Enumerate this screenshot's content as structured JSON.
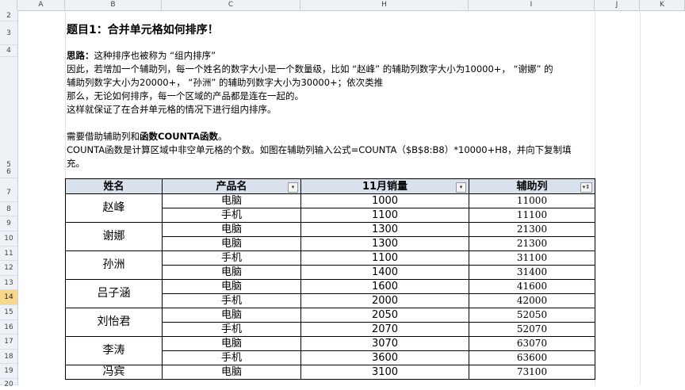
{
  "columns": [
    "A",
    "B",
    "C",
    "H",
    "I",
    "J",
    "K"
  ],
  "rows": [
    "2",
    "3",
    "4",
    "5",
    "6",
    "7",
    "8",
    "9",
    "10",
    "11",
    "12",
    "13",
    "14",
    "15",
    "16",
    "17",
    "18",
    "19",
    "20"
  ],
  "title": "题目1：合并单元格如何排序！",
  "idea": {
    "label": "思路：",
    "line1": "这种排序也被称为 “组内排序”",
    "line2": "因此，若增加一个辅助列，每一个姓名的数字大小是一个数量级，比如 “赵峰” 的辅助列数字大小为10000+， “谢娜” 的",
    "line3": "辅助列数字大小为20000+， “孙洲” 的辅助列数字大小为30000+；依次类推",
    "line4": "那么，无论如何排序，每一个区域的产品都是连在一起的。",
    "line5": " 这样就保证了在合并单元格的情况下进行组内排序。",
    "line6_pre": "需要借助辅助列和",
    "line6_bold": "函数COUNTA函数",
    "line6_post": "。",
    "line7": "COUNTA函数是计算区域中非空单元格的个数。如图在辅助列输入公式=COUNTA（$B$8:B8）*10000+H8，并向下复制填",
    "line8": "充。"
  },
  "table": {
    "headers": [
      "姓名",
      "产品名",
      "11月销量",
      "辅助列"
    ],
    "filter_icon": "▾",
    "sort_icon": "▾↕",
    "groups": [
      {
        "name": "赵峰",
        "rows": [
          [
            "电脑",
            "1000",
            "11000"
          ],
          [
            "手机",
            "1100",
            "11100"
          ]
        ]
      },
      {
        "name": "谢娜",
        "rows": [
          [
            "电脑",
            "1300",
            "21300"
          ],
          [
            "电脑",
            "1300",
            "21300"
          ]
        ]
      },
      {
        "name": "孙洲",
        "rows": [
          [
            "手机",
            "1100",
            "31100"
          ],
          [
            "电脑",
            "1400",
            "31400"
          ]
        ]
      },
      {
        "name": "吕子涵",
        "rows": [
          [
            "电脑",
            "1600",
            "41600"
          ],
          [
            "手机",
            "2000",
            "42000"
          ]
        ]
      },
      {
        "name": "刘怡君",
        "rows": [
          [
            "电脑",
            "2050",
            "52050"
          ],
          [
            "手机",
            "2070",
            "52070"
          ]
        ]
      },
      {
        "name": "李涛",
        "rows": [
          [
            "电脑",
            "3070",
            "63070"
          ],
          [
            "手机",
            "3600",
            "63600"
          ]
        ]
      },
      {
        "name": "冯宾",
        "rows": [
          [
            "电脑",
            "3100",
            "73100"
          ]
        ]
      }
    ]
  }
}
